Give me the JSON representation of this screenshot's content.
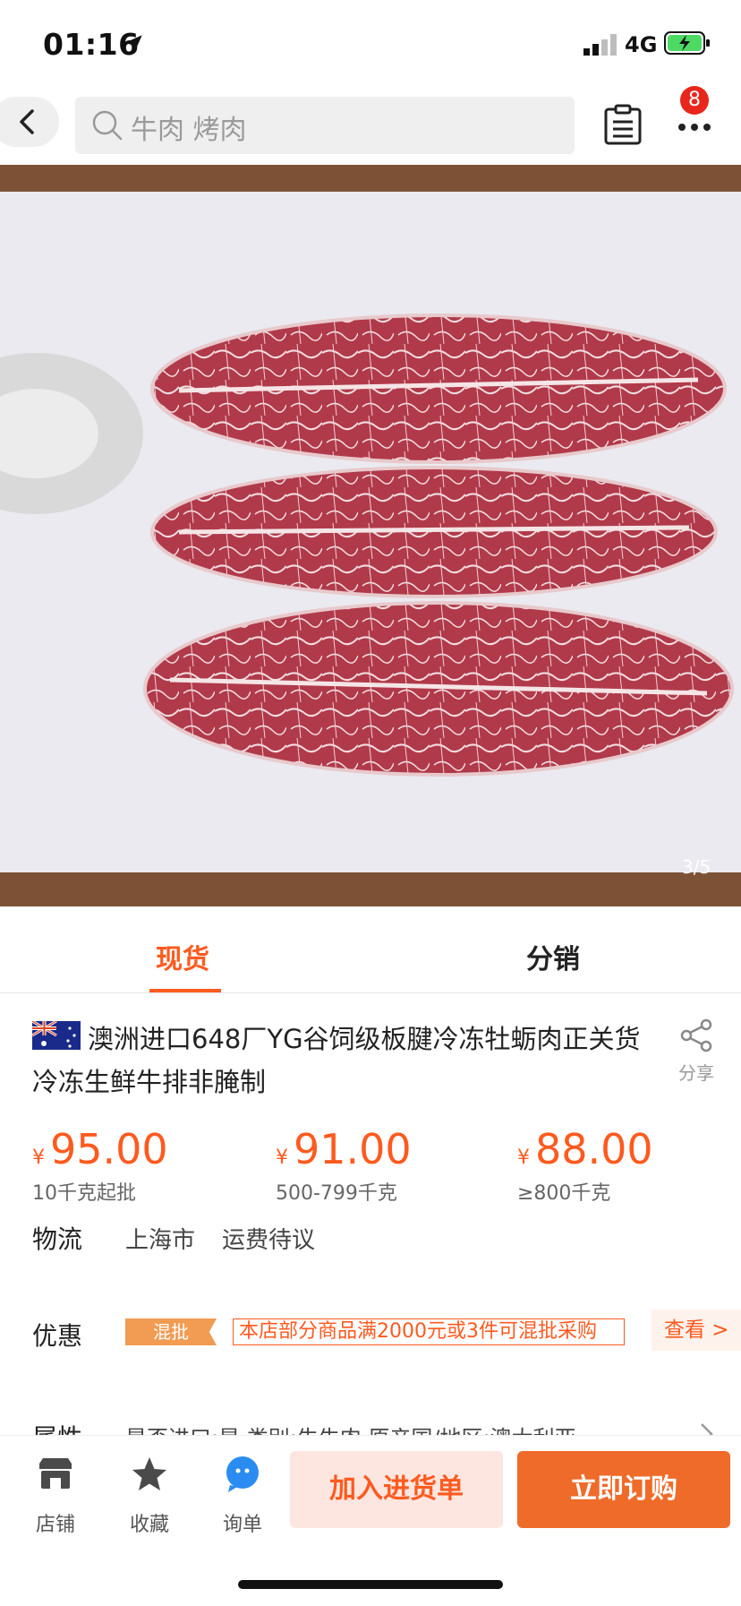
{
  "status": {
    "time": "01:16",
    "network": "4G"
  },
  "nav": {
    "search_text": "牛肉 烤肉",
    "badge_count": "8"
  },
  "gallery": {
    "counter": "3/5"
  },
  "tabs": [
    {
      "label": "现货",
      "active": true
    },
    {
      "label": "分销",
      "active": false
    }
  ],
  "product": {
    "title": "澳洲进口648厂YG谷饲级板腱冷冻牡蛎肉正关货冷冻生鲜牛排非腌制",
    "share_label": "分享"
  },
  "prices": [
    {
      "currency": "¥",
      "price": "95.00",
      "qty": "10千克起批"
    },
    {
      "currency": "¥",
      "price": "91.00",
      "qty": "500-799千克"
    },
    {
      "currency": "¥",
      "price": "88.00",
      "qty": "≥800千克"
    }
  ],
  "logistics": {
    "label": "物流",
    "city": "上海市",
    "fee": "运费待议"
  },
  "promo": {
    "label": "优惠",
    "tag": "混批",
    "text": "本店部分商品满2000元或3件可混批采购",
    "more": "查看 >"
  },
  "attributes": {
    "label": "属性",
    "value": "是否进口:是  类别:牛牛肉  原产国/地区:澳大利亚"
  },
  "bottom_bar": {
    "items": [
      {
        "label": "店铺",
        "icon": "store-icon"
      },
      {
        "label": "收藏",
        "icon": "star-icon"
      },
      {
        "label": "询单",
        "icon": "chat-icon"
      }
    ],
    "add_cart": "加入进货单",
    "buy_now": "立即订购"
  },
  "colors": {
    "accent": "#ff5a1f",
    "buy_button": "#ef6b2a",
    "badge": "#e8261b"
  }
}
